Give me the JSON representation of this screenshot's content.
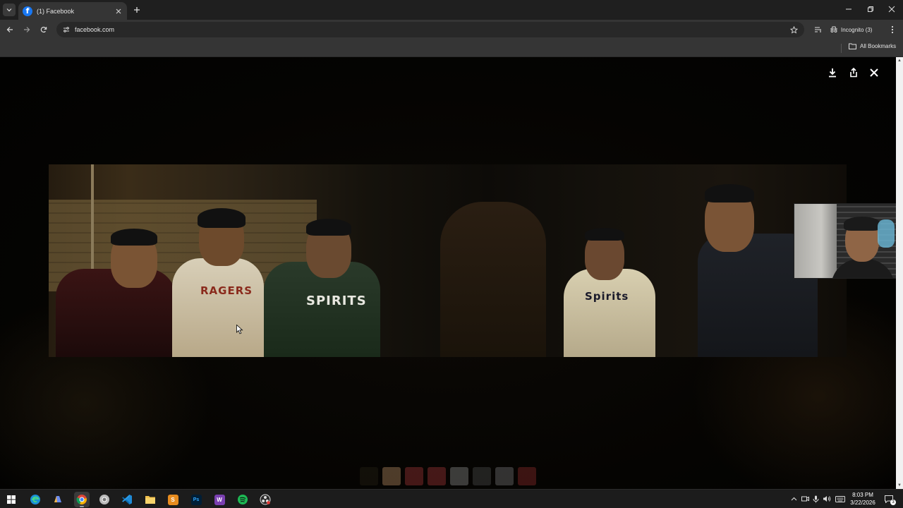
{
  "browser": {
    "tab": {
      "title": "(1) Facebook",
      "favicon": "f"
    },
    "address": {
      "url": "facebook.com"
    },
    "incognito_label": "Incognito (3)",
    "bookmarks": {
      "all_label": "All Bookmarks"
    }
  },
  "viewer": {
    "actions": [
      "download-icon",
      "share-icon",
      "close-icon"
    ],
    "photo": {
      "shirt_texts": [
        "RAGERS",
        "SPIRITS",
        "Spirits"
      ]
    },
    "thumbnails": [
      {
        "color": "#2a2418"
      },
      {
        "color": "#8a6a4a"
      },
      {
        "color": "#7a2a2a"
      },
      {
        "color": "#7a2a2a"
      },
      {
        "color": "#6a6a6a"
      },
      {
        "color": "#3a3a3a"
      },
      {
        "color": "#5a5a5a"
      },
      {
        "color": "#6a2020"
      }
    ]
  },
  "taskbar": {
    "apps": [
      {
        "name": "start",
        "label": "",
        "color": "transparent"
      },
      {
        "name": "edge",
        "label": "",
        "color": "#0f7fbf"
      },
      {
        "name": "copilot",
        "label": "",
        "color": "#5a7ae6"
      },
      {
        "name": "chrome",
        "label": "",
        "color": "#3c3c3c"
      },
      {
        "name": "chrome-profile",
        "label": "",
        "color": "#555"
      },
      {
        "name": "vscode",
        "label": "",
        "color": "#1f6fb8"
      },
      {
        "name": "explorer",
        "label": "",
        "color": "#e8b73a"
      },
      {
        "name": "sublime",
        "label": "S",
        "color": "#e88c1f"
      },
      {
        "name": "photoshop",
        "label": "Ps",
        "color": "#001e36"
      },
      {
        "name": "wattpad",
        "label": "W",
        "color": "#7a3fb0"
      },
      {
        "name": "spotify",
        "label": "",
        "color": "#1db954"
      },
      {
        "name": "obs",
        "label": "",
        "color": "#333"
      }
    ],
    "clock": {
      "time": "8:03 PM",
      "date": "3/22/2026"
    },
    "notification_count": "3"
  }
}
